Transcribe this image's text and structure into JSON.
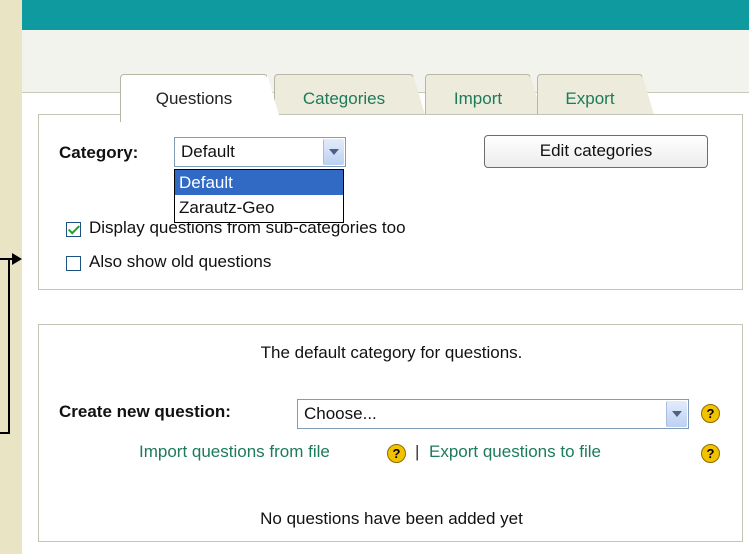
{
  "tabs": [
    {
      "label": "Questions",
      "active": true
    },
    {
      "label": "Categories",
      "active": false
    },
    {
      "label": "Import",
      "active": false
    },
    {
      "label": "Export",
      "active": false
    }
  ],
  "category_panel": {
    "label": "Category:",
    "selected": "Default",
    "options": [
      "Default",
      "Zarautz-Geo"
    ],
    "edit_button": "Edit categories",
    "subcat_checkbox": {
      "label": "Display questions from sub-categories too",
      "checked": true
    },
    "old_checkbox": {
      "label": "Also show old questions",
      "checked": false
    }
  },
  "question_panel": {
    "description": "The default category for questions.",
    "create_label": "Create new question:",
    "create_select": "Choose...",
    "import_link": "Import questions from file",
    "separator": "|",
    "export_link": "Export questions to file",
    "empty_message": "No questions have been added yet"
  },
  "colors": {
    "topbar": "#0f9aa0",
    "link": "#1d7a5b",
    "selection": "#316ac5"
  }
}
